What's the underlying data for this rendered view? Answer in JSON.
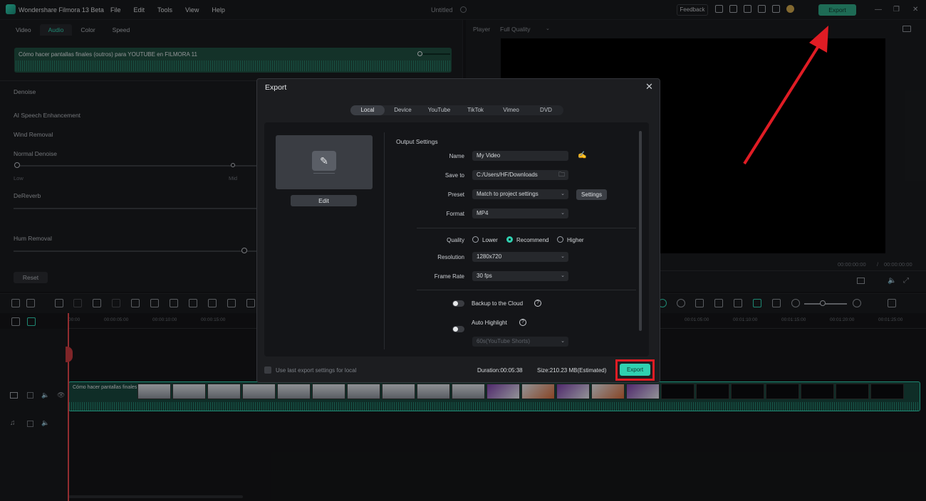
{
  "app": {
    "title": "Wondershare Filmora 13 Beta",
    "document_title": "Untitled"
  },
  "menu": [
    "File",
    "Edit",
    "Tools",
    "View",
    "Help"
  ],
  "top_bar": {
    "feedback_label": "Feedback",
    "export_label": "Export"
  },
  "left_panel": {
    "tabs": [
      "Video",
      "Audio",
      "Color",
      "Speed"
    ],
    "active_tab": "Audio",
    "audio_clip_title": "Cómo hacer pantallas finales (outros) para YOUTUBE en FILMORA 11",
    "sections": {
      "denoise": "Denoise",
      "ai_speech": "AI Speech Enhancement",
      "wind_removal": "Wind Removal",
      "normal_denoise": "Normal Denoise",
      "low": "Low",
      "mid": "Mid",
      "dereverb": "DeReverb",
      "hum_removal": "Hum Removal"
    },
    "reset_label": "Reset"
  },
  "player": {
    "label": "Player",
    "quality": "Full Quality",
    "time_current": "00:00:00:00",
    "time_separator": "/",
    "time_total": "00:00:00:00"
  },
  "timeline": {
    "ruler": [
      "00:00",
      "00:00:05:00",
      "00:00:10:00",
      "00:00:15:00",
      "00:01:05:00",
      "00:01:10:00",
      "00:01:15:00",
      "00:01:20:00",
      "00:01:25:00"
    ],
    "clip_label": "Cómo hacer pantallas finales"
  },
  "dialog": {
    "title": "Export",
    "tabs": [
      "Local",
      "Device",
      "YouTube",
      "TikTok",
      "Vimeo",
      "DVD"
    ],
    "active_tab": "Local",
    "edit_label": "Edit",
    "output_settings_label": "Output Settings",
    "fields": {
      "name_label": "Name",
      "name_value": "My Video",
      "save_to_label": "Save to",
      "save_to_value": "C:/Users/HF/Downloads",
      "preset_label": "Preset",
      "preset_value": "Match to project settings",
      "settings_btn": "Settings",
      "format_label": "Format",
      "format_value": "MP4",
      "quality_label": "Quality",
      "quality_options": [
        "Lower",
        "Recommend",
        "Higher"
      ],
      "quality_selected": "Recommend",
      "resolution_label": "Resolution",
      "resolution_value": "1280x720",
      "frame_rate_label": "Frame Rate",
      "frame_rate_value": "30 fps",
      "backup_label": "Backup to the Cloud",
      "auto_highlight_label": "Auto Highlight",
      "highlight_duration": "60s(YouTube Shorts)"
    },
    "footer": {
      "use_last_label": "Use last export settings for local",
      "duration": "Duration:00:05:38",
      "size": "Size:210.23 MB(Estimated)",
      "export_label": "Export"
    }
  },
  "colors": {
    "accent": "#2fd0b0",
    "annotation": "#e01c24"
  }
}
